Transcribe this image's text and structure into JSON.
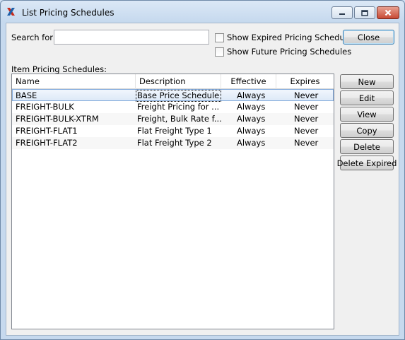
{
  "window": {
    "title": "List Pricing Schedules",
    "icon": "xtuple-x-icon",
    "accent": "#1f5fa8"
  },
  "search": {
    "label": "Search for:",
    "value": "",
    "placeholder": ""
  },
  "options": {
    "show_expired": "Show Expired Pricing Schedules",
    "show_future": "Show Future Pricing Schedules"
  },
  "buttons": {
    "close": "Close",
    "new": "New",
    "edit": "Edit",
    "view": "View",
    "copy": "Copy",
    "delete": "Delete",
    "delete_expired": "Delete Expired"
  },
  "list": {
    "label": "Item Pricing Schedules:",
    "columns": [
      "Name",
      "Description",
      "Effective",
      "Expires"
    ],
    "rows": [
      {
        "name": "BASE",
        "description": "Base Price Schedule",
        "effective": "Always",
        "expires": "Never"
      },
      {
        "name": "FREIGHT-BULK",
        "description": "Freight Pricing for ...",
        "effective": "Always",
        "expires": "Never"
      },
      {
        "name": "FREIGHT-BULK-XTRM",
        "description": "Freight, Bulk Rate f...",
        "effective": "Always",
        "expires": "Never"
      },
      {
        "name": "FREIGHT-FLAT1",
        "description": "Flat Freight Type 1",
        "effective": "Always",
        "expires": "Never"
      },
      {
        "name": "FREIGHT-FLAT2",
        "description": "Flat Freight Type 2",
        "effective": "Always",
        "expires": "Never"
      }
    ]
  }
}
